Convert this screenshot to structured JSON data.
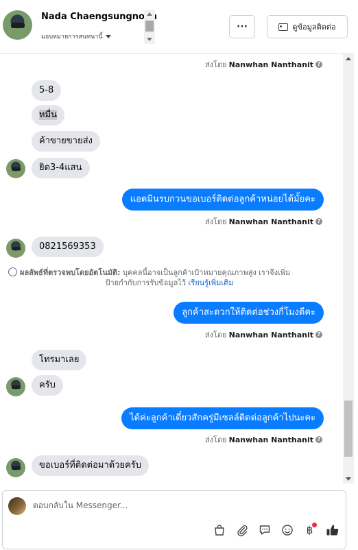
{
  "header": {
    "contact_name": "Nada Chaengsungnoen",
    "assign_label": "มอบหมายการสนทนานี้",
    "more_label": "···",
    "contact_info_label": "ดูข้อมูลติดต่อ"
  },
  "conversation": {
    "sent_by_prefix": "ส่งโดย",
    "agent_name": "Nanwhan Nanthanit",
    "messages": [
      {
        "text": "5-8"
      },
      {
        "text": "หมื่น"
      },
      {
        "text": "ค้าขายขายส่ง"
      },
      {
        "text": "ยิด3-4แสน"
      },
      {
        "text": "แอดมินรบกวนขอเบอร์ติดต่อลูกค้าหน่อยได้มั้ยคะ"
      },
      {
        "text": "0821569353"
      },
      {
        "text": "ลูกค้าสะดวกให้ติดต่อช่วงกี่โมงดีคะ"
      },
      {
        "text": "โทรมาเลย"
      },
      {
        "text": "ครับ"
      },
      {
        "text": "ได้ค่ะลูกค้าเดี๋ยวสักครู่มีเซลล์ติดต่อลูกค้าไปนะคะ"
      },
      {
        "text": "ขอเบอร์ที่ติดต่อมาด้วยครับ"
      }
    ],
    "ai_note": {
      "title": "ผลลัพธ์ที่ตรวจพบโดยอัตโนมัติ:",
      "line1": "บุคคลนี้อาจเป็นลูกค้าเป้าหมายคุณภาพสูง เราจึงเพิ่ม",
      "line2": "ป้ายกำกับการรับข้อมูลไว้",
      "learn_more": "เรียนรู้เพิ่มเติม"
    }
  },
  "composer": {
    "placeholder": "ตอบกลับใน Messenger..."
  },
  "colors": {
    "outgoing_bubble": "#0a7cff",
    "incoming_bubble": "#e4e6eb",
    "notification_dot": "#f02849"
  }
}
